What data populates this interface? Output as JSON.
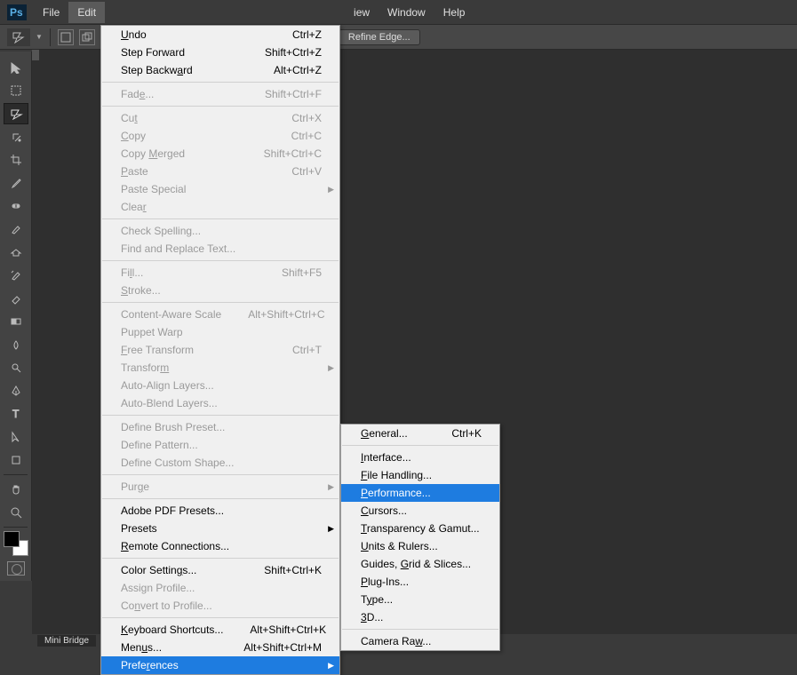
{
  "menubar": {
    "items": [
      "File",
      "Edit",
      "iew",
      "Window",
      "Help"
    ],
    "active_index": 1
  },
  "optionsbar": {
    "refine_edge": "Refine Edge..."
  },
  "toolbox": {
    "tools": [
      "move",
      "rect-marquee",
      "lasso",
      "magic-wand",
      "crop",
      "eyedropper",
      "spot-heal",
      "brush",
      "clone-stamp",
      "history-brush",
      "eraser",
      "gradient",
      "blur",
      "dodge",
      "pen",
      "type",
      "path-select",
      "rectangle",
      "hand",
      "zoom"
    ],
    "selected": "lasso"
  },
  "bottombar": {
    "tab": "Mini Bridge"
  },
  "edit_menu": [
    {
      "label": "Undo",
      "shortcut": "Ctrl+Z",
      "u": 0
    },
    {
      "label": "Step Forward",
      "shortcut": "Shift+Ctrl+Z"
    },
    {
      "label": "Step Backward",
      "shortcut": "Alt+Ctrl+Z",
      "u": 10
    },
    {
      "sep": true
    },
    {
      "label": "Fade...",
      "shortcut": "Shift+Ctrl+F",
      "disabled": true,
      "u": 3
    },
    {
      "sep": true
    },
    {
      "label": "Cut",
      "shortcut": "Ctrl+X",
      "disabled": true,
      "u": 2
    },
    {
      "label": "Copy",
      "shortcut": "Ctrl+C",
      "disabled": true,
      "u": 0
    },
    {
      "label": "Copy Merged",
      "shortcut": "Shift+Ctrl+C",
      "disabled": true,
      "u": 5
    },
    {
      "label": "Paste",
      "shortcut": "Ctrl+V",
      "disabled": true,
      "u": 0
    },
    {
      "label": "Paste Special",
      "disabled": true,
      "submenu": true
    },
    {
      "label": "Clear",
      "disabled": true,
      "u": 4
    },
    {
      "sep": true
    },
    {
      "label": "Check Spelling...",
      "disabled": true
    },
    {
      "label": "Find and Replace Text...",
      "disabled": true
    },
    {
      "sep": true
    },
    {
      "label": "Fill...",
      "shortcut": "Shift+F5",
      "disabled": true,
      "u": 2
    },
    {
      "label": "Stroke...",
      "disabled": true,
      "u": 0
    },
    {
      "sep": true
    },
    {
      "label": "Content-Aware Scale",
      "shortcut": "Alt+Shift+Ctrl+C",
      "disabled": true
    },
    {
      "label": "Puppet Warp",
      "disabled": true
    },
    {
      "label": "Free Transform",
      "shortcut": "Ctrl+T",
      "disabled": true,
      "u": 0
    },
    {
      "label": "Transform",
      "disabled": true,
      "submenu": true,
      "u": 8
    },
    {
      "label": "Auto-Align Layers...",
      "disabled": true
    },
    {
      "label": "Auto-Blend Layers...",
      "disabled": true
    },
    {
      "sep": true
    },
    {
      "label": "Define Brush Preset...",
      "disabled": true
    },
    {
      "label": "Define Pattern...",
      "disabled": true
    },
    {
      "label": "Define Custom Shape...",
      "disabled": true
    },
    {
      "sep": true
    },
    {
      "label": "Purge",
      "disabled": true,
      "submenu": true,
      "u": 3
    },
    {
      "sep": true
    },
    {
      "label": "Adobe PDF Presets..."
    },
    {
      "label": "Presets",
      "submenu": true
    },
    {
      "label": "Remote Connections...",
      "u": 0
    },
    {
      "sep": true
    },
    {
      "label": "Color Settings...",
      "shortcut": "Shift+Ctrl+K",
      "u": 12
    },
    {
      "label": "Assign Profile...",
      "disabled": true
    },
    {
      "label": "Convert to Profile...",
      "disabled": true,
      "u": 2
    },
    {
      "sep": true
    },
    {
      "label": "Keyboard Shortcuts...",
      "shortcut": "Alt+Shift+Ctrl+K",
      "u": 0
    },
    {
      "label": "Menus...",
      "shortcut": "Alt+Shift+Ctrl+M",
      "u": 3
    },
    {
      "label": "Preferences",
      "submenu": true,
      "highlight": true,
      "u": 5
    }
  ],
  "pref_submenu": [
    {
      "label": "General...",
      "shortcut": "Ctrl+K",
      "u": 0
    },
    {
      "sep": true
    },
    {
      "label": "Interface...",
      "u": 0
    },
    {
      "label": "File Handling...",
      "u": 0
    },
    {
      "label": "Performance...",
      "highlight": true,
      "u": 0
    },
    {
      "label": "Cursors...",
      "u": 0
    },
    {
      "label": "Transparency & Gamut...",
      "u": 0
    },
    {
      "label": "Units & Rulers...",
      "u": 0
    },
    {
      "label": "Guides, Grid & Slices...",
      "u": 8
    },
    {
      "label": "Plug-Ins...",
      "u": 0
    },
    {
      "label": "Type...",
      "u": 1
    },
    {
      "label": "3D...",
      "u": 0
    },
    {
      "sep": true
    },
    {
      "label": "Camera Raw...",
      "u": 9
    }
  ]
}
